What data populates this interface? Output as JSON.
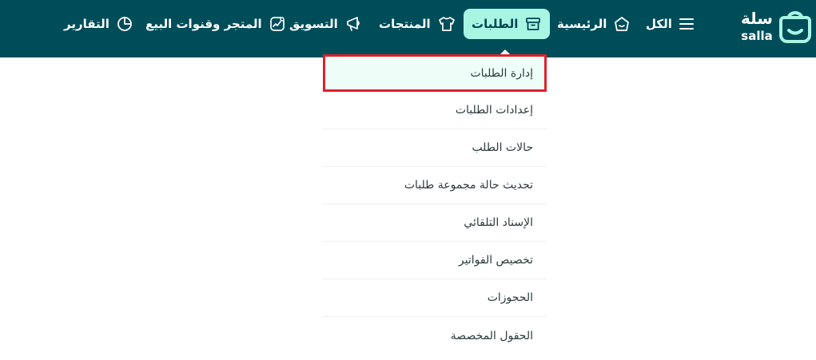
{
  "brand": {
    "name_ar": "سلة",
    "name_en": "salla"
  },
  "nav": {
    "all": "الكل",
    "home": "الرئيسية",
    "orders": "الطلبات",
    "products": "المنتجات",
    "marketing": "التسويق",
    "store_channels": "المتجر وقنوات البيع",
    "reports": "التقارير"
  },
  "orders_menu": {
    "items": [
      "إدارة الطلبات",
      "إعدادات الطلبات",
      "حالات الطلب",
      "تحديث حالة مجموعة طلبات",
      "الإسناد التلقائي",
      "تخصيص الفواتير",
      "الحجوزات",
      "الحقول المخصصة"
    ]
  },
  "colors": {
    "topbar": "#004d5a",
    "active_tab": "#a9f5e4",
    "highlight_border": "#e0202a",
    "highlight_fill": "#effdf8"
  },
  "icons": {
    "all": "menu-icon",
    "home": "home-icon",
    "orders": "box-icon",
    "products": "shirt-icon",
    "marketing": "megaphone-icon",
    "store_channels": "store-chart-icon",
    "reports": "pie-chart-icon"
  }
}
